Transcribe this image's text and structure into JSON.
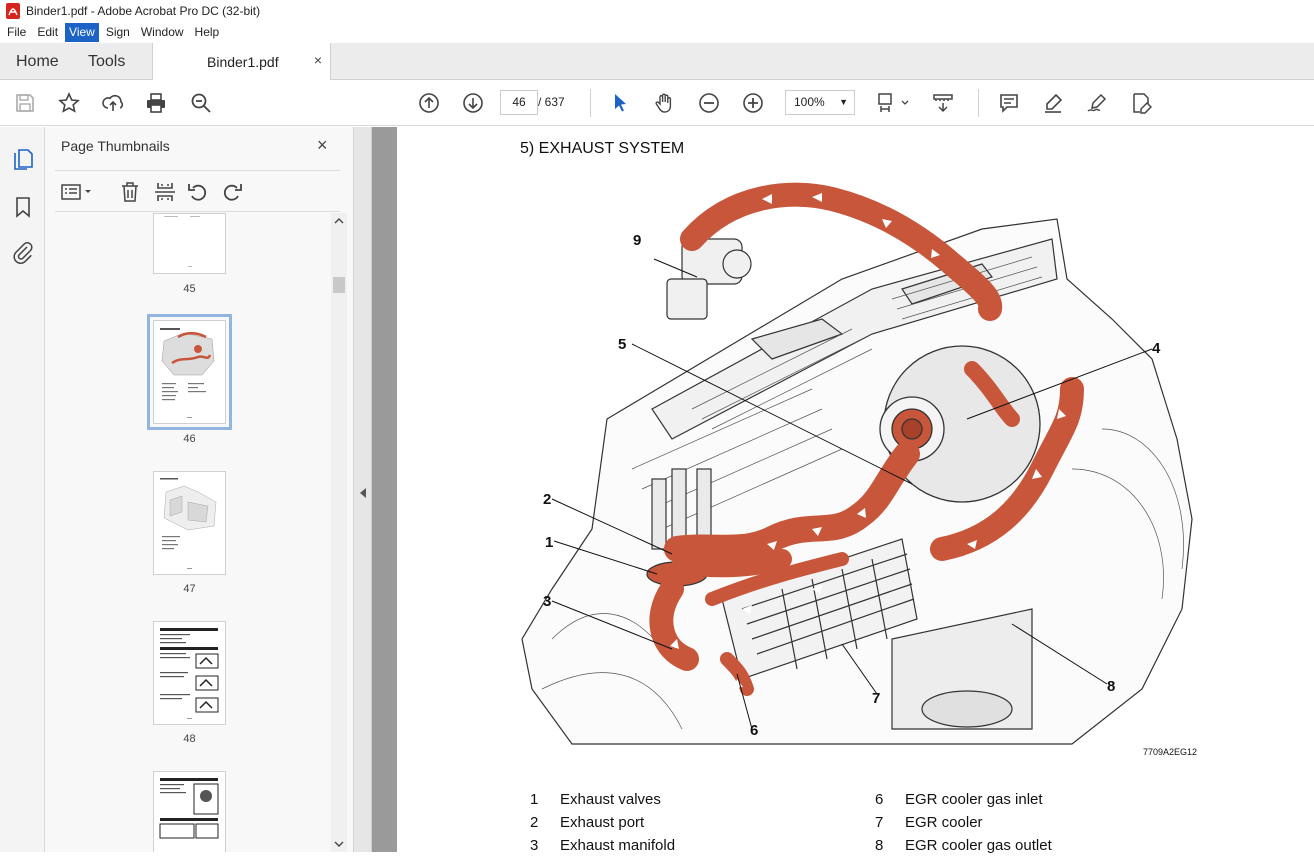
{
  "window": {
    "title": "Binder1.pdf - Adobe Acrobat Pro DC (32-bit)"
  },
  "menu": [
    {
      "label": "File",
      "active": false
    },
    {
      "label": "Edit",
      "active": false
    },
    {
      "label": "View",
      "active": true
    },
    {
      "label": "Sign",
      "active": false
    },
    {
      "label": "Window",
      "active": false
    },
    {
      "label": "Help",
      "active": false
    }
  ],
  "tabs": {
    "home": "Home",
    "tools": "Tools",
    "document": "Binder1.pdf",
    "close": "×"
  },
  "toolbar": {
    "current_page": "46",
    "page_total": "/ 637",
    "zoom": "100%",
    "icons": [
      "save-icon",
      "star-icon",
      "upload-icon",
      "print-icon",
      "zoom-search-icon",
      "page-up-icon",
      "page-down-icon",
      "select-arrow-icon",
      "hand-icon",
      "zoom-out-icon",
      "zoom-in-icon",
      "fit-page-icon",
      "scroll-mode-icon",
      "comment-icon",
      "highlight-icon",
      "sign-icon",
      "edit-pdf-icon"
    ]
  },
  "thumbnails_panel": {
    "title": "Page Thumbnails",
    "close": "×",
    "pages": [
      {
        "label": "45"
      },
      {
        "label": "46",
        "selected": true
      },
      {
        "label": "47"
      },
      {
        "label": "48"
      },
      {
        "label": ""
      }
    ]
  },
  "document": {
    "heading": "5) EXHAUST SYSTEM",
    "figure_code": "7709A2EG12",
    "callouts": [
      "1",
      "2",
      "3",
      "4",
      "5",
      "6",
      "7",
      "8",
      "9"
    ],
    "legend": [
      {
        "num": "1",
        "text": "Exhaust valves"
      },
      {
        "num": "2",
        "text": "Exhaust port"
      },
      {
        "num": "3",
        "text": "Exhaust manifold"
      },
      {
        "num": "6",
        "text": "EGR cooler gas inlet"
      },
      {
        "num": "7",
        "text": "EGR cooler"
      },
      {
        "num": "8",
        "text": "EGR cooler gas outlet"
      }
    ]
  },
  "colors": {
    "accent": "#1c63c5",
    "exhaust_flow": "#c8563a",
    "doc_background": "#9a9a9a"
  }
}
